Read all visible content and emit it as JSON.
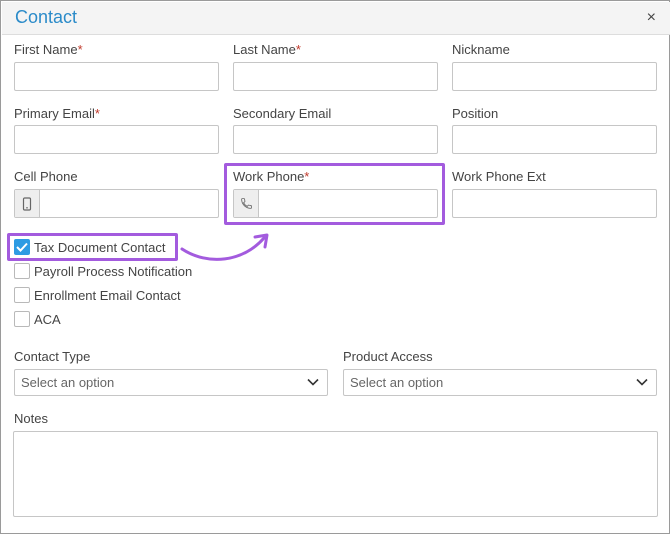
{
  "dialog": {
    "title": "Contact",
    "close_symbol": "×"
  },
  "fields": {
    "first_name": {
      "label": "First Name",
      "required": "*",
      "value": ""
    },
    "last_name": {
      "label": "Last Name",
      "required": "*",
      "value": ""
    },
    "nickname": {
      "label": "Nickname",
      "value": ""
    },
    "primary_email": {
      "label": "Primary Email",
      "required": "*",
      "value": ""
    },
    "secondary_email": {
      "label": "Secondary Email",
      "value": ""
    },
    "position": {
      "label": "Position",
      "value": ""
    },
    "cell_phone": {
      "label": "Cell Phone",
      "icon": "mobile-phone-icon",
      "value": ""
    },
    "work_phone": {
      "label": "Work Phone",
      "required": "*",
      "icon": "phone-icon",
      "value": ""
    },
    "work_phone_ext": {
      "label": "Work Phone Ext",
      "value": ""
    }
  },
  "checkboxes": [
    {
      "label": "Tax Document Contact",
      "checked": true
    },
    {
      "label": "Payroll Process Notification",
      "checked": false
    },
    {
      "label": "Enrollment Email Contact",
      "checked": false
    },
    {
      "label": "ACA",
      "checked": false
    }
  ],
  "selects": {
    "contact_type": {
      "label": "Contact Type",
      "placeholder": "Select an option"
    },
    "product_access": {
      "label": "Product Access",
      "placeholder": "Select an option"
    }
  },
  "notes": {
    "label": "Notes",
    "value": ""
  },
  "colors": {
    "title": "#2b8bc9",
    "highlight": "#a35bde",
    "checkbox_checked": "#2d9be3",
    "required": "#c0392b"
  }
}
